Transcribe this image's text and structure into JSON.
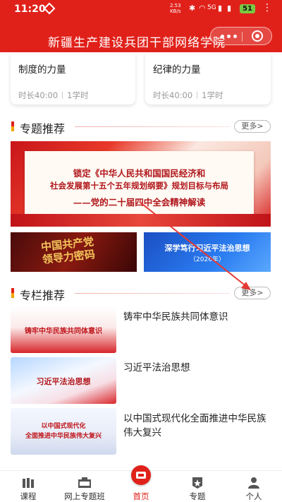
{
  "status_bar": {
    "time": "11:20",
    "speed_value": "2.53",
    "speed_unit": "KB/s",
    "network": "5G",
    "battery": "51"
  },
  "header": {
    "title": "新疆生产建设兵团干部网络学院"
  },
  "courses": [
    {
      "title": "制度的力量",
      "duration": "时长40:00",
      "hours": "1学时"
    },
    {
      "title": "纪律的力量",
      "duration": "时长40:00",
      "hours": "1学时"
    }
  ],
  "topics_section": {
    "title": "专题推荐",
    "more": "更多>",
    "banner_lines": [
      "锁定《中华人民共和国国民经济和",
      "社会发展第十五个五年规划纲要》规划目标与布局",
      "——党的二十届四中全会精神解读"
    ],
    "thumb_left_lines": [
      "中国共产党",
      "领导力密码"
    ],
    "thumb_right_title": "深学笃行习近平法治思想",
    "thumb_right_sub": "（2026年）"
  },
  "columns_section": {
    "title": "专栏推荐",
    "more": "更多>",
    "items": [
      {
        "title": "铸牢中华民族共同体意识",
        "image_text": "铸牢中华民族共同体意识"
      },
      {
        "title": "习近平法治思想",
        "image_text": "习近平法治思想"
      },
      {
        "title": "以中国式现代化全面推进中华民族伟大复兴",
        "image_text_1": "以中国式现代化",
        "image_text_2": "全面推进中华民族伟大复兴"
      }
    ]
  },
  "bottom_nav": {
    "items": [
      {
        "label": "课程",
        "icon": "books-icon"
      },
      {
        "label": "网上专题班",
        "icon": "classroom-icon"
      },
      {
        "label": "首页",
        "icon": "home-icon",
        "active": true
      },
      {
        "label": "专题",
        "icon": "badge-icon"
      },
      {
        "label": "个人",
        "icon": "person-icon"
      }
    ]
  },
  "colors": {
    "brand_red": "#e0211a",
    "accent_gold": "#f2a400",
    "annotation_arrow": "#e53935"
  }
}
